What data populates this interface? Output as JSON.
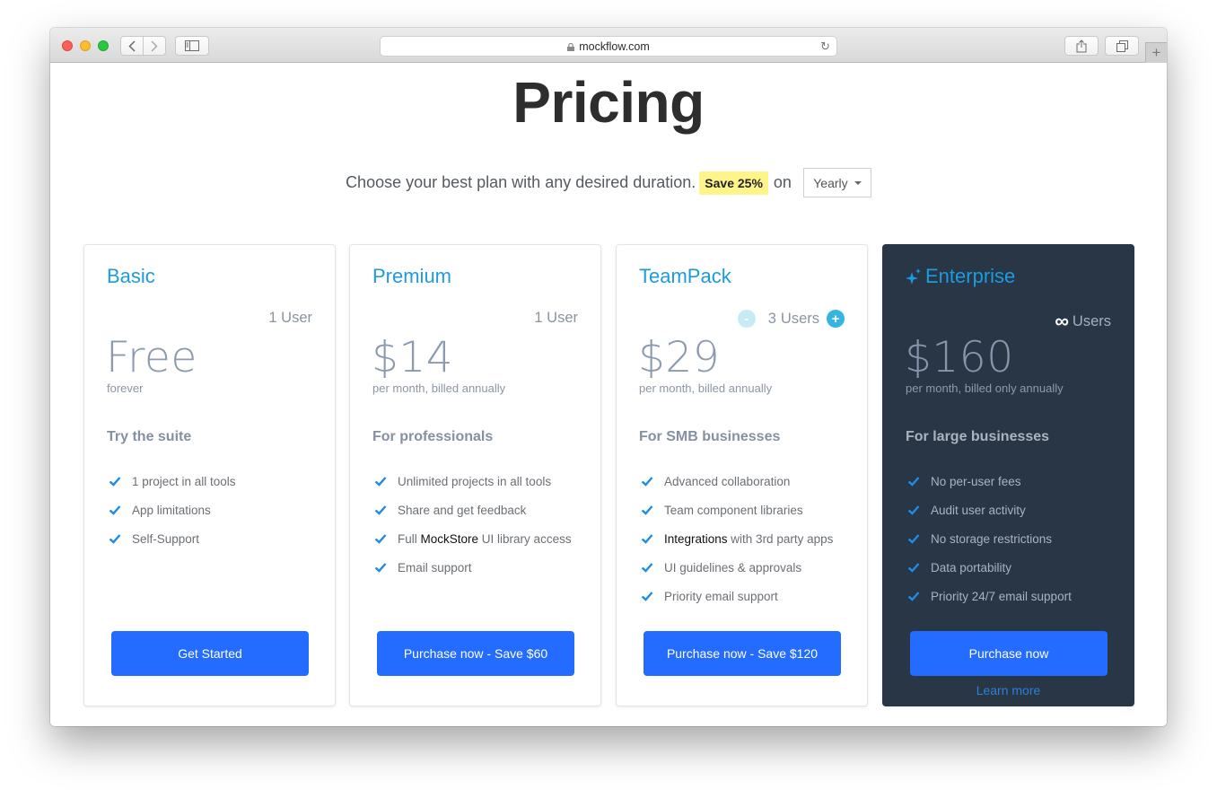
{
  "browser": {
    "url": "mockflow.com",
    "buttons": {
      "back": "back",
      "forward": "forward",
      "sidebar": "sidebar",
      "share": "share",
      "tabs": "tabs",
      "new_tab": "+"
    }
  },
  "page": {
    "title": "Pricing",
    "subtitle": "Choose your best plan with any desired duration.",
    "save_badge": "Save 25%",
    "on_label": "on",
    "duration": {
      "selected": "Yearly"
    }
  },
  "plans": [
    {
      "name": "Basic",
      "users": "1 User",
      "price": "Free",
      "price_note": "forever",
      "tagline": "Try the suite",
      "features": [
        {
          "text": "1 project in all tools"
        },
        {
          "text": "App limitations"
        },
        {
          "text": "Self-Support"
        }
      ],
      "cta": "Get Started"
    },
    {
      "name": "Premium",
      "users": "1 User",
      "price": "$14",
      "price_note": "per month, billed annually",
      "tagline": "For professionals",
      "features": [
        {
          "text": "Unlimited projects in all tools"
        },
        {
          "text": "Share and get feedback"
        },
        {
          "pre": "Full ",
          "highlight": "MockStore",
          "post": " UI library access"
        },
        {
          "text": "Email support"
        }
      ],
      "cta": "Purchase now - Save $60"
    },
    {
      "name": "TeamPack",
      "users_count": "3",
      "users_label": "Users",
      "stepper_minus": "-",
      "stepper_plus": "+",
      "price": "$29",
      "price_note": "per month, billed annually",
      "tagline": "For SMB businesses",
      "features": [
        {
          "text": "Advanced collaboration"
        },
        {
          "text": "Team component libraries"
        },
        {
          "highlight": "Integrations",
          "post": " with 3rd party apps"
        },
        {
          "text": "UI guidelines & approvals"
        },
        {
          "text": "Priority email support"
        }
      ],
      "cta": "Purchase now - Save $120"
    },
    {
      "name": "Enterprise",
      "users_symbol": "∞",
      "users_label": "Users",
      "price": "$160",
      "price_note": "per month, billed only annually",
      "tagline": "For large businesses",
      "features": [
        {
          "text": "No per-user fees"
        },
        {
          "text": "Audit user activity"
        },
        {
          "text": "No storage restrictions"
        },
        {
          "text": "Data portability"
        },
        {
          "text": "Priority 24/7 email support"
        }
      ],
      "cta": "Purchase now",
      "learn_more": "Learn more"
    }
  ],
  "colors": {
    "accent_title": "#1c9be0",
    "cta": "#246bff",
    "check": "#1f8ae8",
    "dark_card": "#283646",
    "badge": "#fff48a"
  }
}
